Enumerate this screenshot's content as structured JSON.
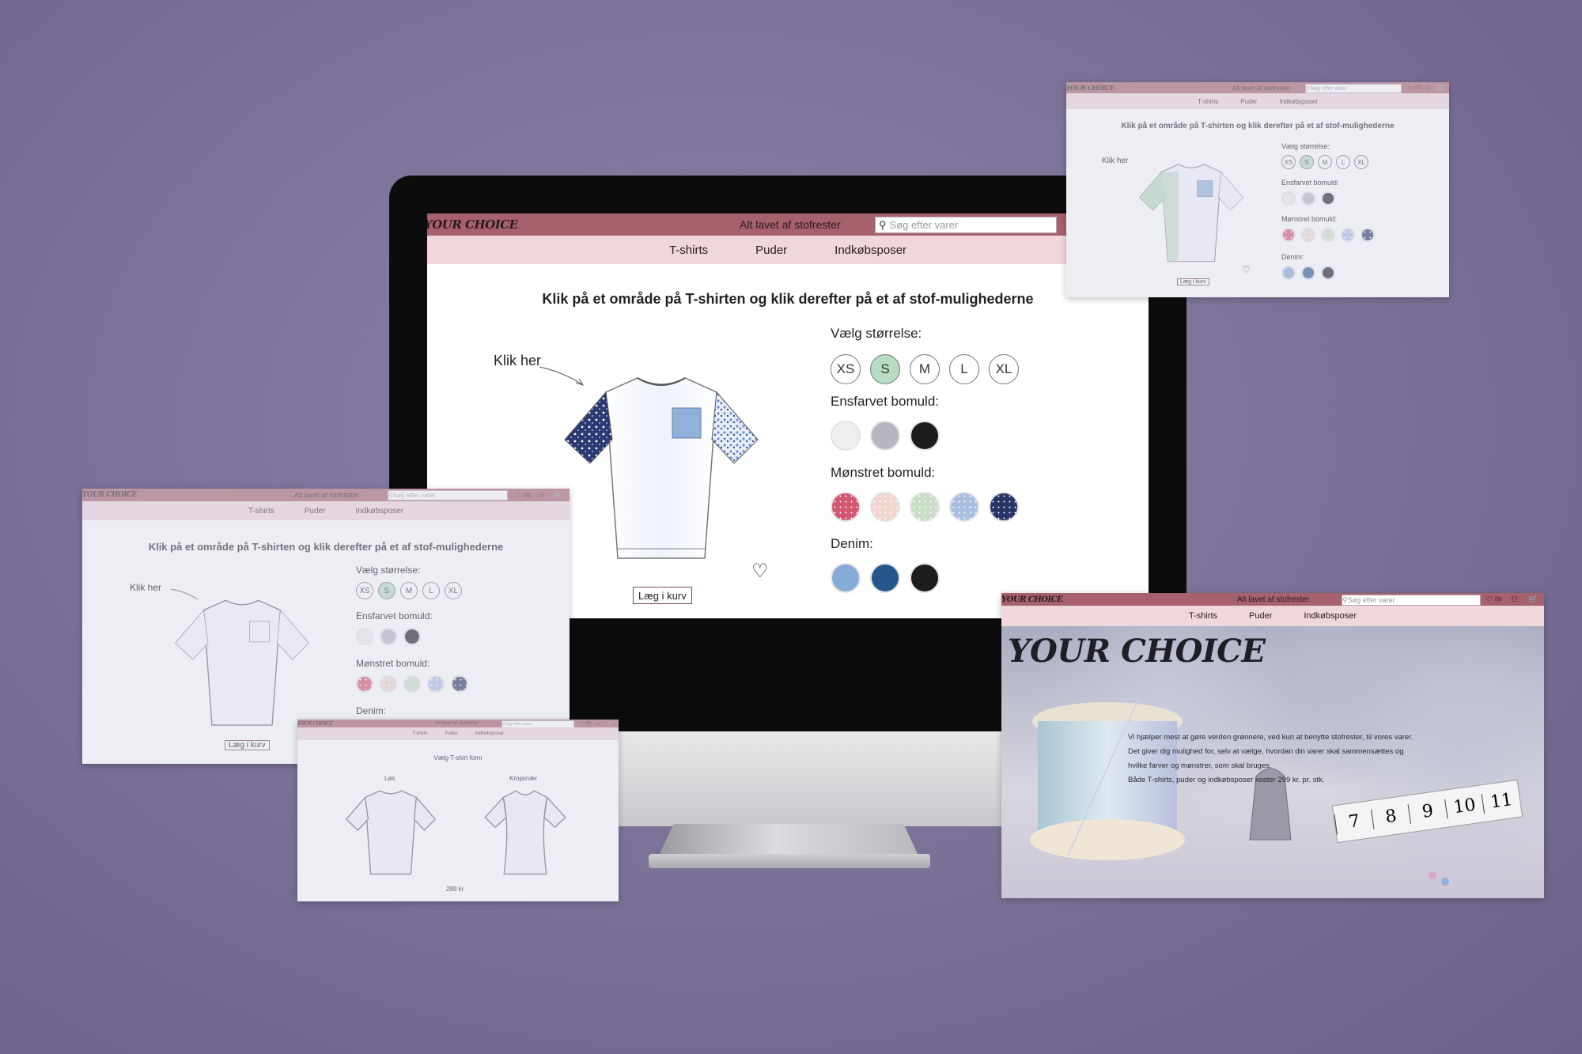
{
  "brand": {
    "logo": "YOUR CHOICE",
    "tagline": "Alt lavet af stofrester"
  },
  "search": {
    "placeholder": "Søg efter varer"
  },
  "header_icons": {
    "wishlist_count": "(0)"
  },
  "nav": [
    "T-shirts",
    "Puder",
    "Indkøbsposer"
  ],
  "customizer": {
    "title": "Klik på et område på T-shirten og klik derefter på et af stof-mulighederne",
    "hint": "Klik her",
    "size_label": "Vælg størrelse:",
    "sizes": [
      "XS",
      "S",
      "M",
      "L",
      "XL"
    ],
    "selected_size": "S",
    "plain_label": "Ensfarvet bomuld:",
    "plain_colors": [
      "#eeeeee",
      "#b7b5bf",
      "#1c1c1e"
    ],
    "pattern_label": "Mønstret bomuld:",
    "pattern_colors": [
      "#d5566f",
      "#f0d6cf",
      "#c9dfc5",
      "#a9bfe0",
      "#283566"
    ],
    "denim_label": "Denim:",
    "denim_colors": [
      "#84acd6",
      "#25578d",
      "#1c1c1e"
    ],
    "add_to_cart": "Læg i kurv"
  },
  "form_page": {
    "title": "Vælg T-shirt form",
    "options": [
      "Løs",
      "Kropsnær"
    ],
    "price": "299 kr."
  },
  "home": {
    "hero_title": "YOUR CHOICE",
    "paragraph": [
      "Vi hjælper mest at gøre verden grønnere, ved kun at benytte stofrester, til vores varer.",
      "Det giver dig mulighed for, selv at vælge, hvordan din varer skal sammensættes og",
      "hvilke farver og mønstrer, som skal bruges.",
      "Både T-shirts, puder og indkøbsposer koster 299 kr. pr. stk."
    ],
    "tape_numbers": [
      "7",
      "8",
      "9",
      "10",
      "11"
    ]
  }
}
